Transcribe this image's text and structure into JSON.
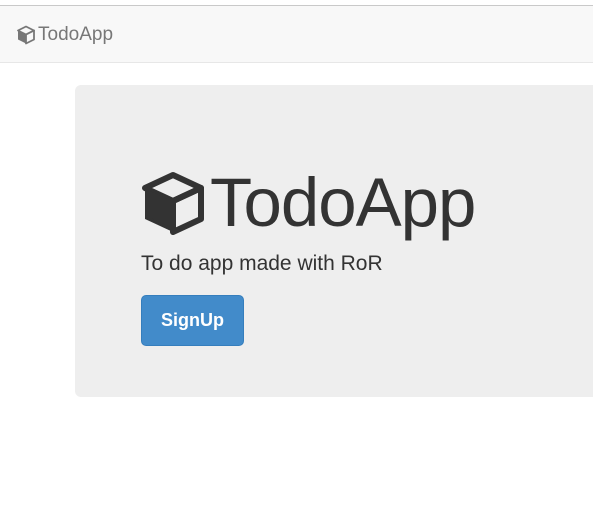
{
  "navbar": {
    "brand_icon": "cube-icon",
    "brand_text": "TodoApp"
  },
  "hero": {
    "icon": "cube-icon",
    "title": "TodoApp",
    "tagline": "To do app made with RoR",
    "signup_label": "SignUp"
  },
  "colors": {
    "primary_button": "#428bca",
    "jumbotron_bg": "#eeeeee",
    "navbar_bg": "#f8f8f8"
  }
}
